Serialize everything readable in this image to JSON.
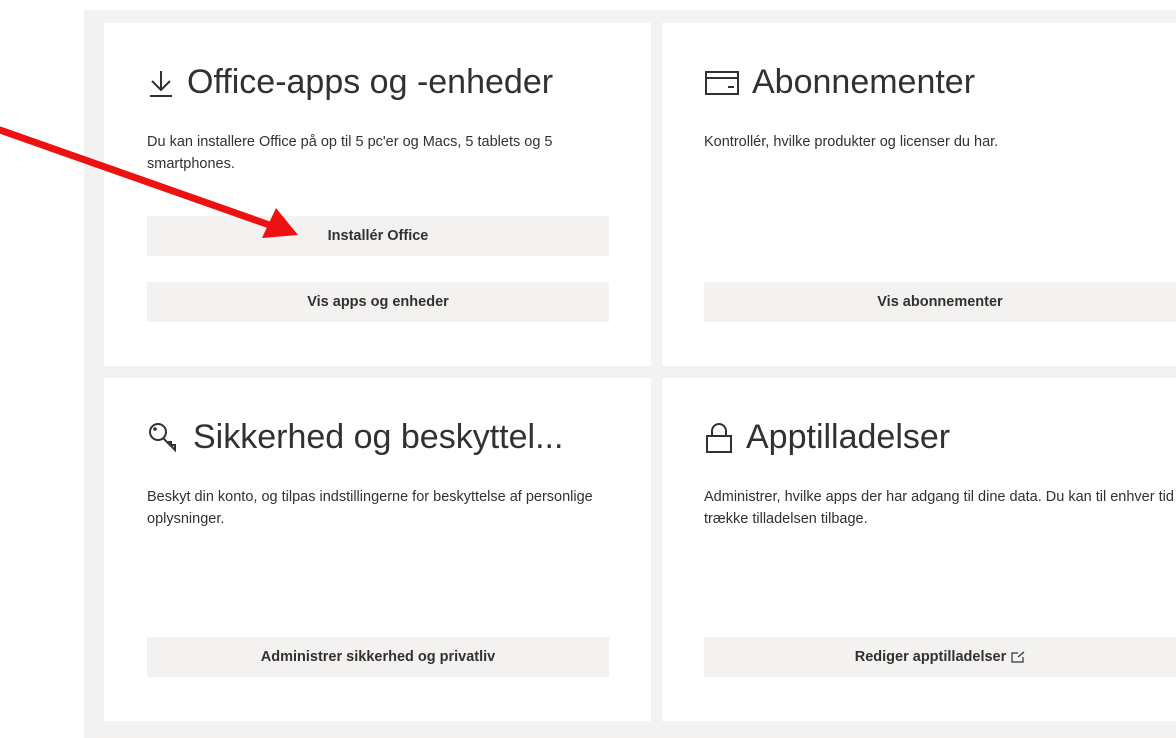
{
  "cards": {
    "apps": {
      "title": "Office-apps og -enheder",
      "icon": "download-icon",
      "description": "Du kan installere Office på op til 5 pc'er og Macs, 5 tablets og 5 smartphones.",
      "primary_button": "Installér Office",
      "secondary_button": "Vis apps og enheder"
    },
    "subscriptions": {
      "title": "Abonnementer",
      "icon": "card-icon",
      "description": "Kontrollér, hvilke produkter og licenser du har.",
      "button": "Vis abonnementer"
    },
    "security": {
      "title": "Sikkerhed og beskyttel...",
      "icon": "key-icon",
      "description": "Beskyt din konto, og tilpas indstillingerne for beskyttelse af personlige oplysninger.",
      "button": "Administrer sikkerhed og privatliv"
    },
    "permissions": {
      "title": "Apptilladelser",
      "icon": "lock-icon",
      "description": "Administrer, hvilke apps der har adgang til dine data. Du kan til enhver tid trække tilladelsen tilbage.",
      "button": "Rediger apptilladelser",
      "button_icon": "external-link-icon"
    }
  },
  "annotation": {
    "icon": "red-arrow-icon",
    "color": "#ee1111",
    "points_to": "Installér Office"
  },
  "colors": {
    "panel_bg": "#f3f2f1",
    "card_bg": "#ffffff",
    "button_bg": "#f3f2f1",
    "text": "#323130"
  }
}
